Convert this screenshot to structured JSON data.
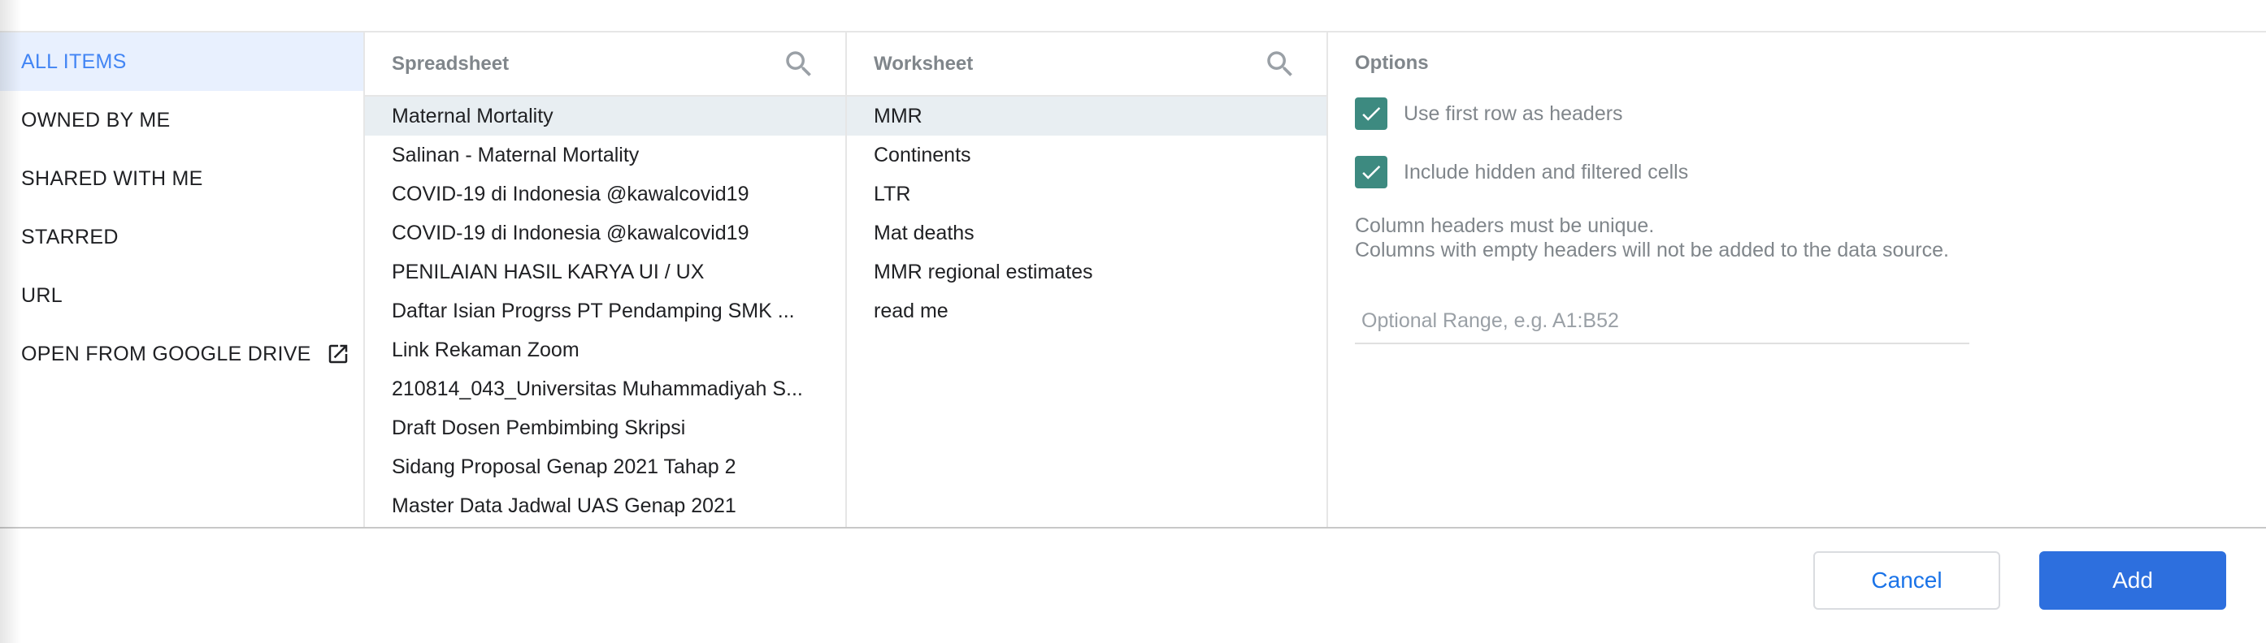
{
  "sidebar": {
    "items": [
      {
        "label": "ALL ITEMS",
        "active": true
      },
      {
        "label": "OWNED BY ME"
      },
      {
        "label": "SHARED WITH ME"
      },
      {
        "label": "STARRED"
      },
      {
        "label": "URL"
      },
      {
        "label": "OPEN FROM GOOGLE DRIVE",
        "icon": "open-external-icon"
      }
    ]
  },
  "spreadsheet": {
    "title": "Spreadsheet",
    "icon": "search-icon",
    "selected_index": 0,
    "items": [
      "Maternal Mortality",
      "Salinan - Maternal Mortality",
      "COVID-19 di Indonesia @kawalcovid19",
      "COVID-19 di Indonesia @kawalcovid19",
      "PENILAIAN HASIL KARYA UI / UX",
      "Daftar Isian Progrss PT Pendamping SMK ...",
      "Link Rekaman Zoom",
      "210814_043_Universitas Muhammadiyah S...",
      "Draft Dosen Pembimbing Skripsi",
      "Sidang Proposal Genap 2021 Tahap 2",
      "Master Data Jadwal UAS Genap 2021"
    ]
  },
  "worksheet": {
    "title": "Worksheet",
    "icon": "search-icon",
    "selected_index": 0,
    "items": [
      "MMR",
      "Continents",
      "LTR",
      "Mat deaths",
      "MMR regional estimates",
      "read me"
    ]
  },
  "options": {
    "title": "Options",
    "use_first_row": {
      "label": "Use first row as headers",
      "checked": true
    },
    "include_hidden": {
      "label": "Include hidden and filtered cells",
      "checked": true
    },
    "note_line1": "Column headers must be unique.",
    "note_line2": "Columns with empty headers will not be added to the data source.",
    "range_placeholder": "Optional Range, e.g. A1:B52",
    "range_value": ""
  },
  "footer": {
    "cancel_label": "Cancel",
    "add_label": "Add"
  },
  "colors": {
    "accent": "#4285f4",
    "selected_bg": "#e8f0fe",
    "checkbox": "#3d8a80",
    "add_button": "#2d6fde"
  }
}
